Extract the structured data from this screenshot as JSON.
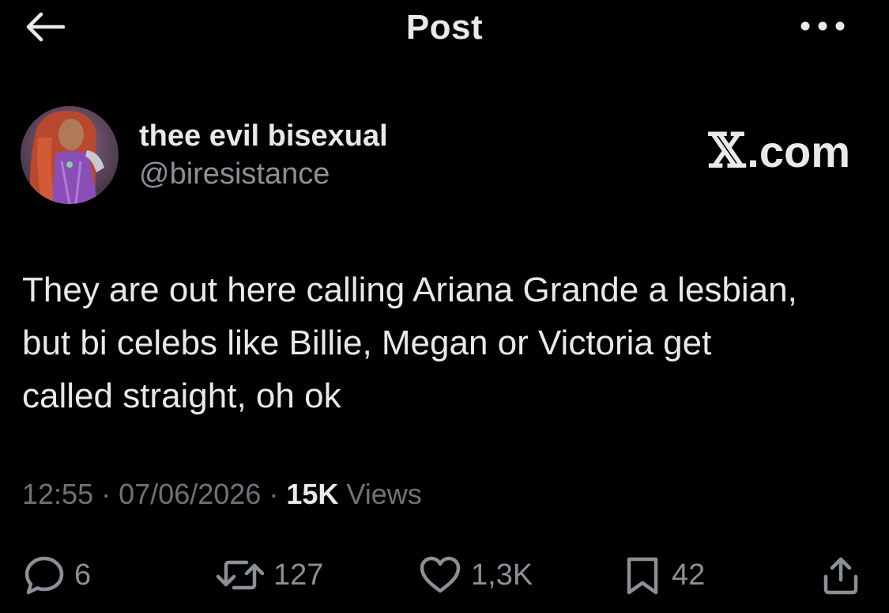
{
  "header": {
    "title": "Post",
    "back_icon": "back-arrow-icon",
    "more_icon": "more-options-icon"
  },
  "post": {
    "author": {
      "display_name": "thee evil bisexual",
      "handle": "@biresistance",
      "avatar": "avatar-image"
    },
    "brand": {
      "x_glyph": "𝕏",
      "text": ".com"
    },
    "text": "They are out here calling Ariana Grande a lesbian,\nbut bi celebs like Billie, Megan or Victoria get\ncalled straight, oh ok",
    "meta": {
      "time": "12:55",
      "separator": "·",
      "date": "07/06/2026",
      "views_count": "15K",
      "views_label": "Views"
    },
    "actions": {
      "replies": "6",
      "reposts": "127",
      "likes": "1,3K",
      "bookmarks": "42"
    }
  },
  "colors": {
    "background": "#000000",
    "primary_text": "#e7e9ea",
    "secondary_text": "#8b9097"
  }
}
